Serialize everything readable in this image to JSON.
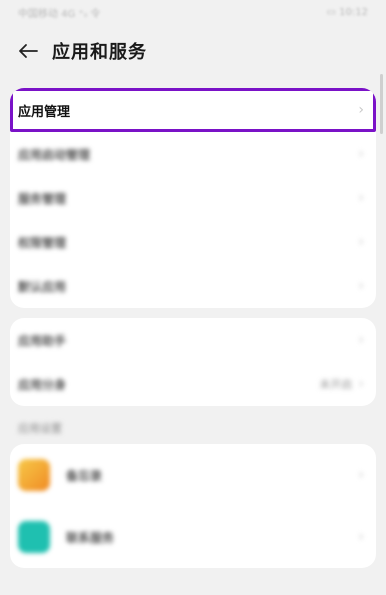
{
  "status_bar": {
    "left_text": "中国移动 4G ⁺ᵢₗ 令",
    "right_text": "▭ 10:12"
  },
  "header": {
    "title": "应用和服务"
  },
  "group1": [
    {
      "label": "应用管理",
      "selected": true
    },
    {
      "label": "应用启动管理"
    },
    {
      "label": "服务管理"
    },
    {
      "label": "权限管理"
    },
    {
      "label": "默认应用"
    }
  ],
  "group2": [
    {
      "label": "应用助手"
    },
    {
      "label": "应用分身",
      "value": "未开启"
    }
  ],
  "section_label": "应用设置",
  "apps": [
    {
      "label": "备忘录",
      "icon_color": "#f4a623",
      "icon": "memo-app-icon"
    },
    {
      "label": "联系服务",
      "icon_color": "#1fc0b0",
      "icon": "phone-app-icon"
    }
  ],
  "colors": {
    "selection_outline": "#7a12c7"
  }
}
